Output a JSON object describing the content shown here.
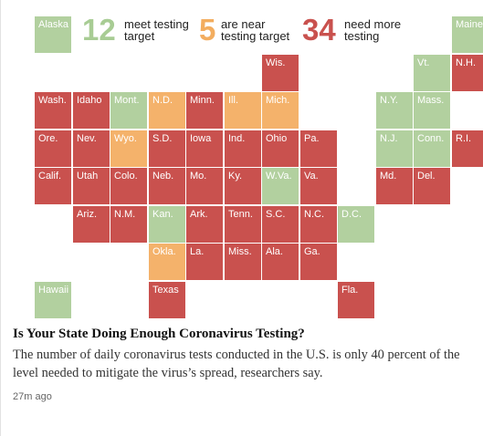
{
  "legend": [
    {
      "count": "12",
      "label_line1": "meet testing",
      "label_line2": "target",
      "color": "#a8cc94"
    },
    {
      "count": "5",
      "label_line1": "are near",
      "label_line2": "testing target",
      "color": "#f3ad5f"
    },
    {
      "count": "34",
      "label_line1": "need more",
      "label_line2": "testing",
      "color": "#c9514e"
    }
  ],
  "colors": {
    "red": "#c9514e",
    "green": "#b2d09f",
    "orange": "#f4b26b"
  },
  "states": [
    {
      "abbr": "Alaska",
      "status": "green",
      "col": 0,
      "row": 0
    },
    {
      "abbr": "Maine",
      "status": "green",
      "col": 11,
      "row": 0
    },
    {
      "abbr": "Wis.",
      "status": "red",
      "col": 6,
      "row": 1
    },
    {
      "abbr": "Vt.",
      "status": "green",
      "col": 10,
      "row": 1
    },
    {
      "abbr": "N.H.",
      "status": "red",
      "col": 11,
      "row": 1
    },
    {
      "abbr": "Wash.",
      "status": "red",
      "col": 0,
      "row": 2
    },
    {
      "abbr": "Idaho",
      "status": "red",
      "col": 1,
      "row": 2
    },
    {
      "abbr": "Mont.",
      "status": "green",
      "col": 2,
      "row": 2
    },
    {
      "abbr": "N.D.",
      "status": "orange",
      "col": 3,
      "row": 2
    },
    {
      "abbr": "Minn.",
      "status": "red",
      "col": 4,
      "row": 2
    },
    {
      "abbr": "Ill.",
      "status": "orange",
      "col": 5,
      "row": 2
    },
    {
      "abbr": "Mich.",
      "status": "orange",
      "col": 6,
      "row": 2
    },
    {
      "abbr": "N.Y.",
      "status": "green",
      "col": 9,
      "row": 2
    },
    {
      "abbr": "Mass.",
      "status": "green",
      "col": 10,
      "row": 2
    },
    {
      "abbr": "Ore.",
      "status": "red",
      "col": 0,
      "row": 3
    },
    {
      "abbr": "Nev.",
      "status": "red",
      "col": 1,
      "row": 3
    },
    {
      "abbr": "Wyo.",
      "status": "orange",
      "col": 2,
      "row": 3
    },
    {
      "abbr": "S.D.",
      "status": "red",
      "col": 3,
      "row": 3
    },
    {
      "abbr": "Iowa",
      "status": "red",
      "col": 4,
      "row": 3
    },
    {
      "abbr": "Ind.",
      "status": "red",
      "col": 5,
      "row": 3
    },
    {
      "abbr": "Ohio",
      "status": "red",
      "col": 6,
      "row": 3
    },
    {
      "abbr": "Pa.",
      "status": "red",
      "col": 7,
      "row": 3
    },
    {
      "abbr": "N.J.",
      "status": "green",
      "col": 9,
      "row": 3
    },
    {
      "abbr": "Conn.",
      "status": "green",
      "col": 10,
      "row": 3
    },
    {
      "abbr": "R.I.",
      "status": "red",
      "col": 11,
      "row": 3
    },
    {
      "abbr": "Calif.",
      "status": "red",
      "col": 0,
      "row": 4
    },
    {
      "abbr": "Utah",
      "status": "red",
      "col": 1,
      "row": 4
    },
    {
      "abbr": "Colo.",
      "status": "red",
      "col": 2,
      "row": 4
    },
    {
      "abbr": "Neb.",
      "status": "red",
      "col": 3,
      "row": 4
    },
    {
      "abbr": "Mo.",
      "status": "red",
      "col": 4,
      "row": 4
    },
    {
      "abbr": "Ky.",
      "status": "red",
      "col": 5,
      "row": 4
    },
    {
      "abbr": "W.Va.",
      "status": "green",
      "col": 6,
      "row": 4
    },
    {
      "abbr": "Va.",
      "status": "red",
      "col": 7,
      "row": 4
    },
    {
      "abbr": "Md.",
      "status": "red",
      "col": 9,
      "row": 4
    },
    {
      "abbr": "Del.",
      "status": "red",
      "col": 10,
      "row": 4
    },
    {
      "abbr": "Ariz.",
      "status": "red",
      "col": 1,
      "row": 5
    },
    {
      "abbr": "N.M.",
      "status": "red",
      "col": 2,
      "row": 5
    },
    {
      "abbr": "Kan.",
      "status": "green",
      "col": 3,
      "row": 5
    },
    {
      "abbr": "Ark.",
      "status": "red",
      "col": 4,
      "row": 5
    },
    {
      "abbr": "Tenn.",
      "status": "red",
      "col": 5,
      "row": 5
    },
    {
      "abbr": "S.C.",
      "status": "red",
      "col": 6,
      "row": 5
    },
    {
      "abbr": "N.C.",
      "status": "red",
      "col": 7,
      "row": 5
    },
    {
      "abbr": "D.C.",
      "status": "green",
      "col": 8,
      "row": 5
    },
    {
      "abbr": "Okla.",
      "status": "orange",
      "col": 3,
      "row": 6
    },
    {
      "abbr": "La.",
      "status": "red",
      "col": 4,
      "row": 6
    },
    {
      "abbr": "Miss.",
      "status": "red",
      "col": 5,
      "row": 6
    },
    {
      "abbr": "Ala.",
      "status": "red",
      "col": 6,
      "row": 6
    },
    {
      "abbr": "Ga.",
      "status": "red",
      "col": 7,
      "row": 6
    },
    {
      "abbr": "Hawaii",
      "status": "green",
      "col": 0,
      "row": 7
    },
    {
      "abbr": "Texas",
      "status": "red",
      "col": 3,
      "row": 7
    },
    {
      "abbr": "Fla.",
      "status": "red",
      "col": 8,
      "row": 7
    }
  ],
  "article": {
    "headline": "Is Your State Doing Enough Coronavirus Testing?",
    "summary": "The number of daily coronavirus tests conducted in the U.S. is only 40 percent of the level needed to mitigate the virus’s spread, researchers say.",
    "timestamp": "27m ago"
  }
}
